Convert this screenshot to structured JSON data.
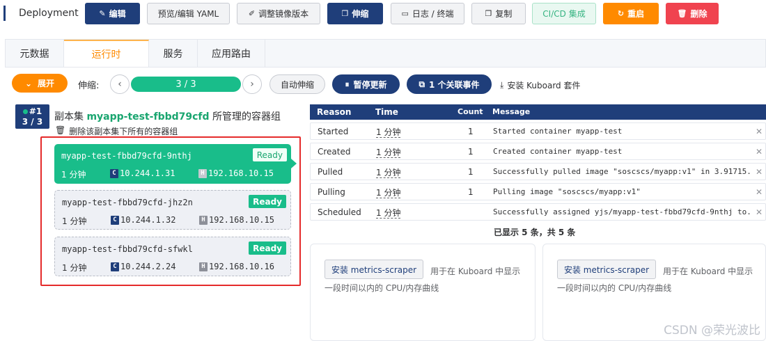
{
  "toolbar": {
    "kind": "Deployment",
    "edit": "编辑",
    "preview_yaml": "预览/编辑 YAML",
    "adjust_image": "调整镜像版本",
    "scale": "伸缩",
    "logs": "日志 / 终端",
    "copy": "复制",
    "cicd": "CI/CD 集成",
    "restart": "重启",
    "delete": "删除"
  },
  "tabs": [
    {
      "label": "元数据",
      "active": false
    },
    {
      "label": "运行时",
      "active": true
    },
    {
      "label": "服务",
      "active": false
    },
    {
      "label": "应用路由",
      "active": false
    }
  ],
  "controls": {
    "expand": "展开",
    "scale_label": "伸缩:",
    "replicas": "3 / 3",
    "autoscale": "自动伸缩",
    "pause": "暂停更新",
    "events": "1 个关联事件",
    "install_kuboard": "安装 Kuboard 套件"
  },
  "replicaset": {
    "badge_index": "#1",
    "badge_count": "3 / 3",
    "title_prefix": "副本集",
    "name": "myapp-test-fbbd79cfd",
    "title_suffix": "所管理的容器组",
    "delete_pods": "删除该副本集下所有的容器组"
  },
  "pods": [
    {
      "name": "myapp-test-fbbd79cfd-9nthj",
      "status": "Ready",
      "age": "1 分钟",
      "pod_ip": "10.244.1.31",
      "host_ip": "192.168.10.15",
      "selected": true
    },
    {
      "name": "myapp-test-fbbd79cfd-jhz2n",
      "status": "Ready",
      "age": "1 分钟",
      "pod_ip": "10.244.1.32",
      "host_ip": "192.168.10.15",
      "selected": false
    },
    {
      "name": "myapp-test-fbbd79cfd-sfwkl",
      "status": "Ready",
      "age": "1 分钟",
      "pod_ip": "10.244.2.24",
      "host_ip": "192.168.10.16",
      "selected": false
    }
  ],
  "events": {
    "headers": {
      "reason": "Reason",
      "time": "Time",
      "count": "Count",
      "message": "Message"
    },
    "rows": [
      {
        "reason": "Started",
        "time": "1 分钟",
        "count": "1",
        "message": "Started container myapp-test"
      },
      {
        "reason": "Created",
        "time": "1 分钟",
        "count": "1",
        "message": "Created container myapp-test"
      },
      {
        "reason": "Pulled",
        "time": "1 分钟",
        "count": "1",
        "message": "Successfully pulled image \"soscscs/myapp:v1\" in 3.91715..."
      },
      {
        "reason": "Pulling",
        "time": "1 分钟",
        "count": "1",
        "message": "Pulling image \"soscscs/myapp:v1\""
      },
      {
        "reason": "Scheduled",
        "time": "1 分钟",
        "count": "",
        "message": "Successfully assigned yjs/myapp-test-fbbd79cfd-9nthj to..."
      }
    ],
    "summary": "已显示 5 条，共 5 条"
  },
  "metrics": [
    {
      "button": "安装 metrics-scraper",
      "desc": "用于在 Kuboard 中显示一段时间以内的 CPU/内存曲线"
    },
    {
      "button": "安装 metrics-scraper",
      "desc": "用于在 Kuboard 中显示一段时间以内的 CPU/内存曲线"
    }
  ],
  "watermark": "CSDN @荣光波比",
  "colors": {
    "primary": "#1f3e7a",
    "accent": "#ff8a00",
    "success": "#19bd8a",
    "danger": "#f0434f"
  }
}
